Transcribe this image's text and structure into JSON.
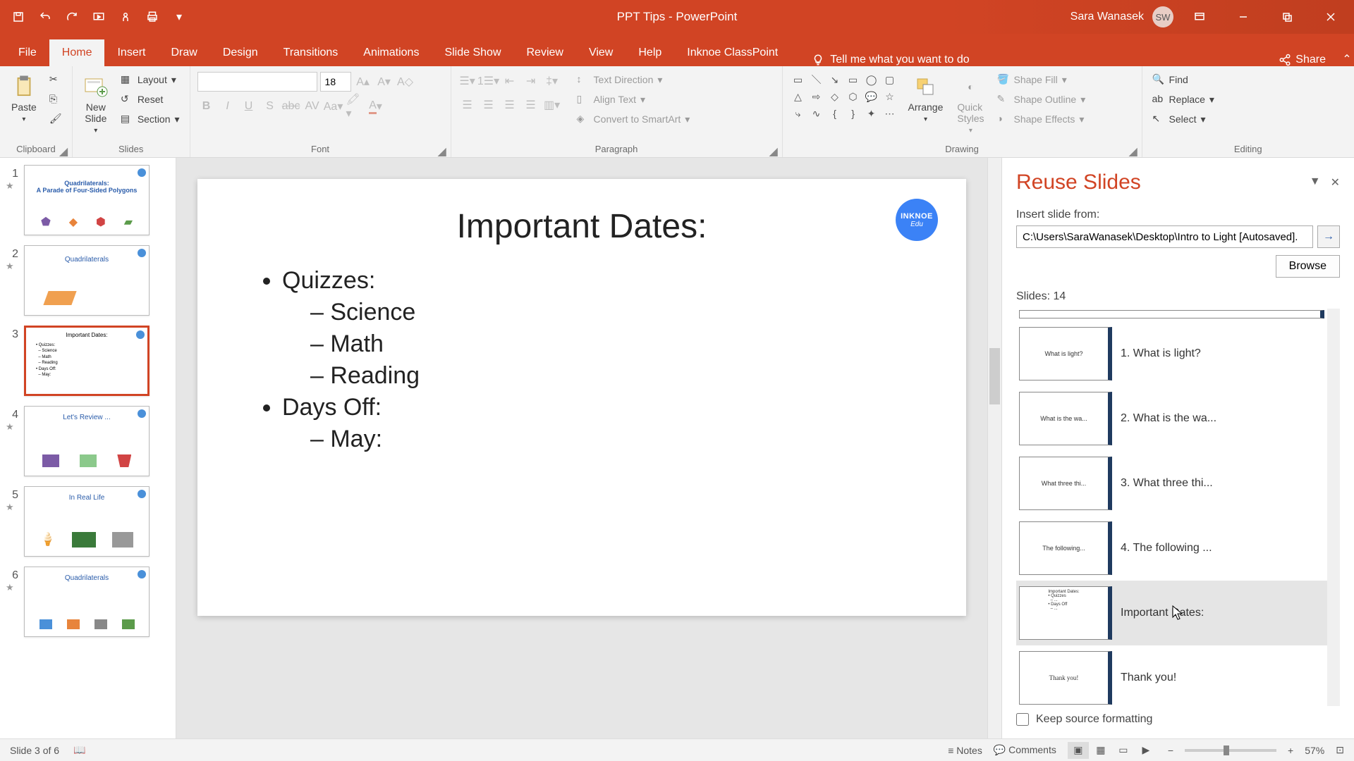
{
  "titlebar": {
    "doc_title": "PPT Tips  -  PowerPoint",
    "user_name": "Sara Wanasek",
    "user_initials": "SW"
  },
  "tabs": {
    "file": "File",
    "home": "Home",
    "insert": "Insert",
    "draw": "Draw",
    "design": "Design",
    "transitions": "Transitions",
    "animations": "Animations",
    "slideshow": "Slide Show",
    "review": "Review",
    "view": "View",
    "help": "Help",
    "inknoe": "Inknoe ClassPoint",
    "tellme": "Tell me what you want to do",
    "share": "Share"
  },
  "ribbon": {
    "clipboard": {
      "label": "Clipboard",
      "paste": "Paste"
    },
    "slides": {
      "label": "Slides",
      "newslide": "New\nSlide",
      "layout": "Layout",
      "reset": "Reset",
      "section": "Section"
    },
    "font": {
      "label": "Font",
      "size": "18"
    },
    "paragraph": {
      "label": "Paragraph",
      "textdir": "Text Direction",
      "align": "Align Text",
      "smartart": "Convert to SmartArt"
    },
    "drawing": {
      "label": "Drawing",
      "arrange": "Arrange",
      "quickstyles": "Quick\nStyles",
      "fill": "Shape Fill",
      "outline": "Shape Outline",
      "effects": "Shape Effects"
    },
    "editing": {
      "label": "Editing",
      "find": "Find",
      "replace": "Replace",
      "select": "Select"
    }
  },
  "thumbnails": [
    {
      "num": "1",
      "title": "Quadrilaterals:"
    },
    {
      "num": "2",
      "title": "Quadrilaterals"
    },
    {
      "num": "3",
      "title": "Important Dates:"
    },
    {
      "num": "4",
      "title": "Let's Review"
    },
    {
      "num": "5",
      "title": "In Real Life"
    },
    {
      "num": "6",
      "title": "Quadrilaterals"
    }
  ],
  "slide": {
    "title": "Important Dates:",
    "b1": "Quizzes:",
    "b1a": "Science",
    "b1b": "Math",
    "b1c": "Reading",
    "b2": "Days Off:",
    "b2a": "May:",
    "logo1": "INKNOE",
    "logo2": "Edu"
  },
  "reuse": {
    "title": "Reuse Slides",
    "insert_from": "Insert slide from:",
    "path": "C:\\Users\\SaraWanasek\\Desktop\\Intro to Light [Autosaved].",
    "browse": "Browse",
    "count": "Slides: 14",
    "items": [
      {
        "label": "1. What is light?"
      },
      {
        "label": "2. What is the wa..."
      },
      {
        "label": "3. What three thi..."
      },
      {
        "label": "4. The following ..."
      },
      {
        "label": "Important Dates:"
      },
      {
        "label": "Thank you!"
      }
    ],
    "keep": "Keep source formatting"
  },
  "status": {
    "slide": "Slide 3 of 6",
    "notes": "Notes",
    "comments": "Comments",
    "zoom": "57%"
  }
}
